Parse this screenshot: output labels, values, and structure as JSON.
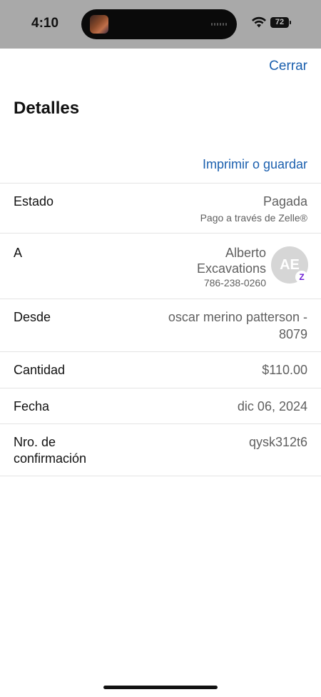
{
  "status_bar": {
    "time": "4:10",
    "battery": "72"
  },
  "header": {
    "close_label": "Cerrar",
    "title": "Detalles",
    "print_label": "Imprimir o guardar"
  },
  "details": {
    "status": {
      "label": "Estado",
      "value": "Pagada",
      "sub": "Pago a través de Zelle®"
    },
    "recipient": {
      "label": "A",
      "name_line1": "Alberto",
      "name_line2": "Excavations",
      "phone": "786-238-0260",
      "initials": "AE",
      "badge": "Z"
    },
    "sender": {
      "label": "Desde",
      "value_line1": "oscar merino patterson -",
      "value_line2": "8079"
    },
    "amount": {
      "label": "Cantidad",
      "value": "$110.00"
    },
    "date": {
      "label": "Fecha",
      "value": "dic 06, 2024"
    },
    "confirmation": {
      "label_line1": "Nro. de",
      "label_line2": "confirmación",
      "value": "qysk312t6"
    }
  },
  "colors": {
    "accent": "#1a5fae",
    "zelle": "#6d1ed4",
    "status_bar_bg": "#a9a9a9"
  }
}
